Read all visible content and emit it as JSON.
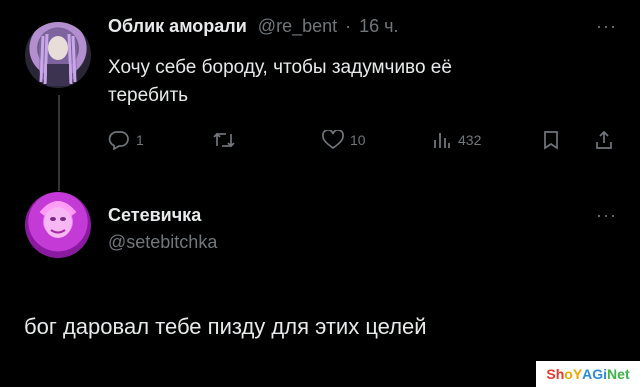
{
  "tweet1": {
    "display_name": "Облик аморали",
    "handle": "@re_bent",
    "separator": "·",
    "time": "16 ч.",
    "text_line1": "Хочу себе бороду, чтобы задумчиво её",
    "text_line2": "теребить",
    "more": "···",
    "actions": {
      "reply_count": "1",
      "retweet_count": "",
      "like_count": "10",
      "views_count": "432"
    }
  },
  "tweet2": {
    "display_name": "Сетевичка",
    "handle": "@setebitchka",
    "more": "···",
    "text": "бог даровал тебе пизду для этих целей"
  },
  "watermark": {
    "part1": "Sh",
    "part2": "oY",
    "part3": "AGi",
    "part4": "Net",
    "colors": {
      "a": "#e63a2e",
      "b": "#f2a600",
      "c": "#2e8bd6",
      "d": "#3bb54a"
    }
  }
}
